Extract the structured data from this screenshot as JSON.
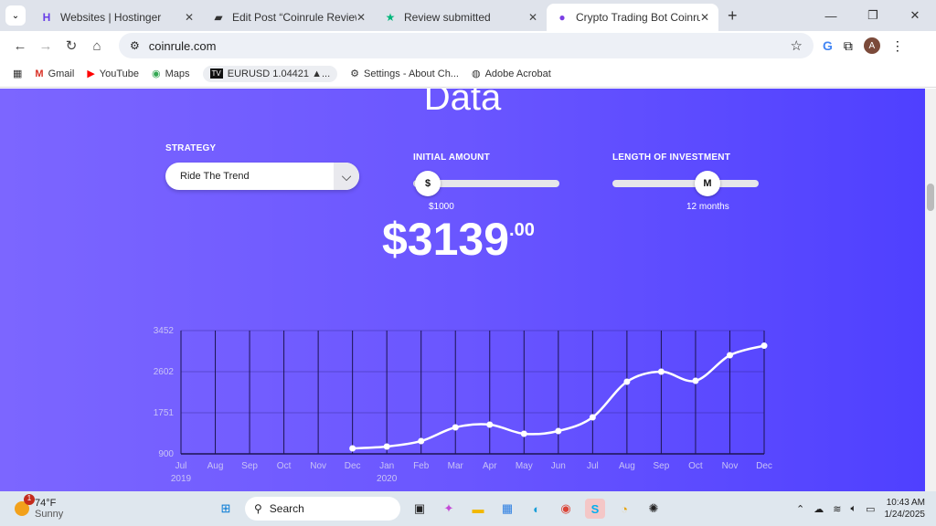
{
  "browser": {
    "tabs": [
      {
        "title": "Websites | Hostinger",
        "icon": "hostinger-icon",
        "color": "#673de6"
      },
      {
        "title": "Edit Post “Coinrule Review best",
        "icon": "wordpress-edit-icon",
        "color": "#333333"
      },
      {
        "title": "Review submitted",
        "icon": "star-icon",
        "color": "#00b67a"
      },
      {
        "title": "Crypto Trading Bot Coinrule",
        "icon": "coinrule-icon",
        "color": "#7b3fe4",
        "active": true
      }
    ],
    "url": "coinrule.com",
    "avatar_letter": "A",
    "bookmarks": [
      {
        "label": "Gmail",
        "icon": "gmail-icon"
      },
      {
        "label": "YouTube",
        "icon": "youtube-icon"
      },
      {
        "label": "Maps",
        "icon": "maps-icon"
      },
      {
        "label": "EURUSD 1.04421 ▲...",
        "icon": "tradingview-icon"
      },
      {
        "label": "Settings - About Ch...",
        "icon": "gear-icon"
      },
      {
        "label": "Adobe Acrobat",
        "icon": "globe-icon"
      }
    ]
  },
  "page": {
    "heading": "Data",
    "strategy_label": "STRATEGY",
    "strategy_value": "Ride The Trend",
    "initial_amount_label": "INITIAL AMOUNT",
    "initial_amount_knob": "$",
    "initial_amount_value": "$1000",
    "initial_amount_level": 0.1,
    "length_label": "LENGTH OF INVESTMENT",
    "length_knob": "M",
    "length_value": "12 months",
    "length_level": 0.65,
    "result_main": "$3139",
    "result_cents": ".00"
  },
  "chart_data": {
    "type": "line",
    "categories": [
      "Jul",
      "Aug",
      "Sep",
      "Oct",
      "Nov",
      "Dec",
      "Jan",
      "Feb",
      "Mar",
      "Apr",
      "May",
      "Jun",
      "Jul",
      "Aug",
      "Sep",
      "Oct",
      "Nov",
      "Dec"
    ],
    "year_labels": [
      {
        "index": 0,
        "label": "2019"
      },
      {
        "index": 6,
        "label": "2020"
      }
    ],
    "yticks": [
      900,
      1751,
      2602,
      3452
    ],
    "ylim": [
      900,
      3452
    ],
    "series": [
      {
        "values": [
          null,
          null,
          null,
          null,
          null,
          1013,
          1051,
          1165,
          1448,
          1505,
          1316,
          1373,
          1656,
          2393,
          2601,
          2412,
          2941,
          3139
        ]
      }
    ],
    "grid": true,
    "line_color": "#ffffff"
  },
  "taskbar": {
    "temp": "74°F",
    "condition": "Sunny",
    "badge": "1",
    "search_placeholder": "Search",
    "time": "10:43 AM",
    "date": "1/24/2025"
  }
}
